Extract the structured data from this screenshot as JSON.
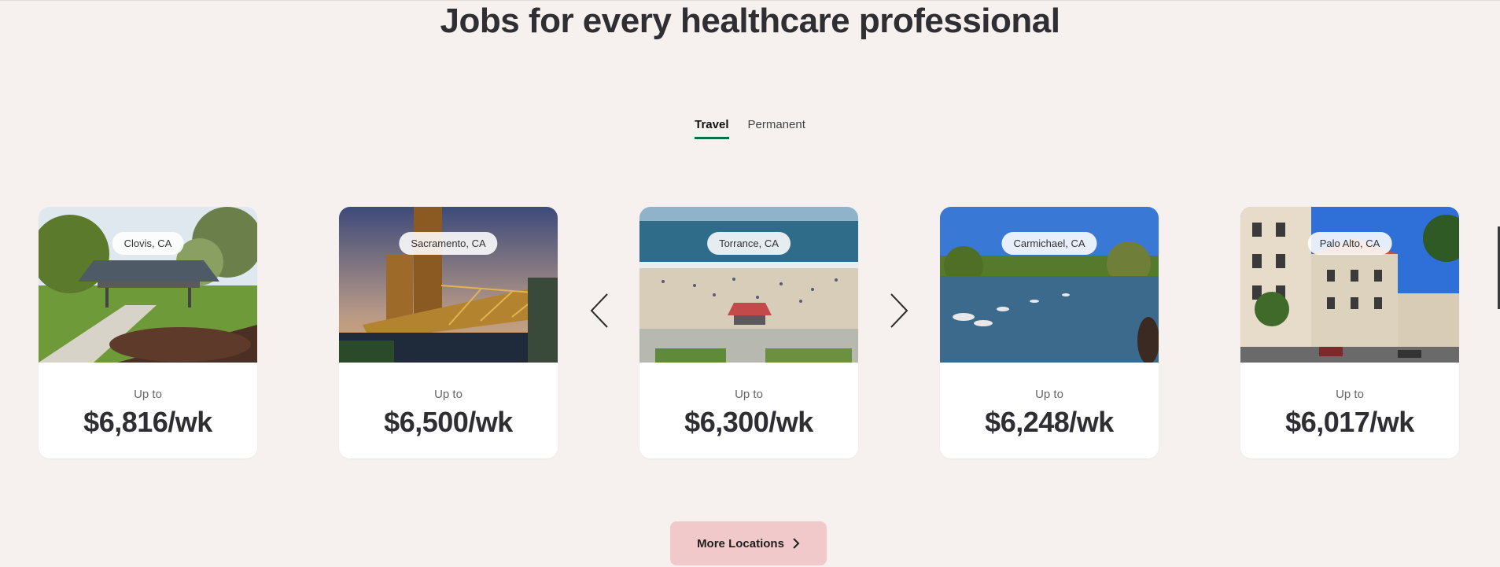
{
  "title": "Jobs for every healthcare professional",
  "tabs": [
    {
      "label": "Travel",
      "active": true
    },
    {
      "label": "Permanent",
      "active": false
    }
  ],
  "cards": [
    {
      "location": "Clovis, CA",
      "upto": "Up to",
      "price": "$6,816/wk"
    },
    {
      "location": "Sacramento, CA",
      "upto": "Up to",
      "price": "$6,500/wk"
    },
    {
      "location": "Torrance, CA",
      "upto": "Up to",
      "price": "$6,300/wk"
    },
    {
      "location": "Carmichael, CA",
      "upto": "Up to",
      "price": "$6,248/wk"
    },
    {
      "location": "Palo Alto, CA",
      "upto": "Up to",
      "price": "$6,017/wk"
    }
  ],
  "more_button": {
    "label": "More Locations"
  },
  "colors": {
    "background": "#f6f1ef",
    "tab_underline": "#0f6b48",
    "button_bg": "#f2c9cb",
    "card_bg": "#ffffff"
  },
  "icons": {
    "prev": "chevron-left-icon",
    "next": "chevron-right-icon",
    "more": "chevron-right-icon"
  }
}
